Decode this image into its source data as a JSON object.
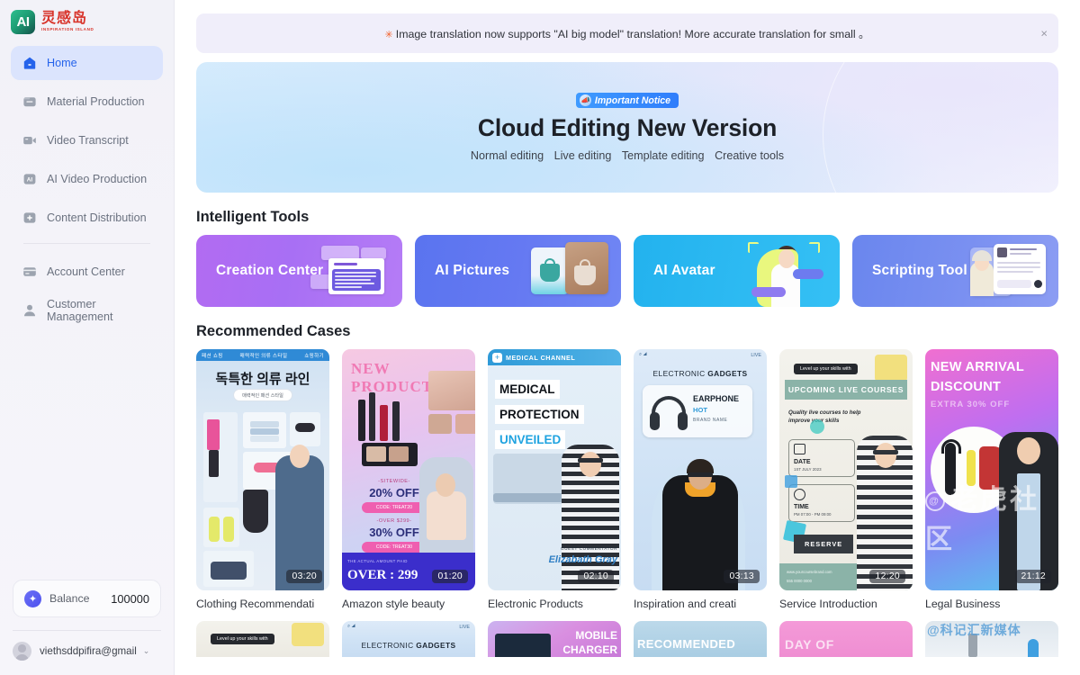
{
  "brand": {
    "logo_mark": "AI",
    "name_cn": "灵感岛",
    "name_en": "INSPIRATION ISLAND",
    "logo_icon": "ai-logo-icon"
  },
  "sidebar": {
    "items": [
      {
        "label": "Home",
        "icon": "home-icon",
        "active": true
      },
      {
        "label": "Material Production",
        "icon": "folder-icon",
        "active": false
      },
      {
        "label": "Video Transcript",
        "icon": "video-camera-icon",
        "active": false
      },
      {
        "label": "AI Video Production",
        "icon": "ai-square-icon",
        "active": false
      },
      {
        "label": "Content Distribution",
        "icon": "plus-square-icon",
        "active": false
      },
      {
        "label": "Account Center",
        "icon": "card-icon",
        "active": false
      },
      {
        "label": "Customer Management",
        "icon": "user-icon",
        "active": false
      }
    ],
    "balance": {
      "label": "Balance",
      "value": "100000",
      "icon": "coin-icon"
    },
    "account": {
      "email": "viethsddpifira@gmail",
      "caret": "⌄",
      "avatar": "user-avatar"
    }
  },
  "notice": {
    "emoji": "✳",
    "text": "Image translation now supports \"AI big model\" translation! More accurate translation for small 。",
    "close": "×"
  },
  "hero": {
    "badge": "Important Notice",
    "badge_icon": "megaphone-icon",
    "title": "Cloud Editing New Version",
    "subtitle_items": [
      "Normal editing",
      "Live editing",
      "Template editing",
      "Creative tools"
    ]
  },
  "tools": {
    "heading": "Intelligent Tools",
    "items": [
      {
        "label": "Creation Center",
        "color": "#a86ff4"
      },
      {
        "label": "AI Pictures",
        "color": "#6579f2"
      },
      {
        "label": "AI Avatar",
        "color": "#2dbaf2"
      },
      {
        "label": "Scripting Tool",
        "color": "#7a90f1"
      }
    ]
  },
  "cases": {
    "heading": "Recommended Cases",
    "items": [
      {
        "title": "Clothing Recommendati",
        "duration": "03:20",
        "theme": "th-clothing",
        "overlay": {
          "band_left": "패션 쇼핑",
          "band_center": "매력적인 의류 스타일",
          "band_right": "쇼핑하기",
          "headline": "독특한 의류 라인",
          "pill": "매력적인 패션 스타일"
        }
      },
      {
        "title": "Amazon style beauty",
        "duration": "01:20",
        "theme": "th-beauty",
        "overlay": {
          "l1": "NEW",
          "l2": "PRODUCT",
          "promo1_kicker": "-SITEWIDE-",
          "promo1": "20% OFF",
          "promo1_code": "CODE: TREAT20",
          "promo2_kicker": "-OVER $299-",
          "promo2": "30% OFF",
          "promo2_code": "CODE: TREAT30",
          "footer_kicker": "THE ACTUAL AMOUNT PAID",
          "footer": "OVER : 299"
        }
      },
      {
        "title": "Electronic Products",
        "duration": "02:10",
        "theme": "th-medical",
        "overlay": {
          "channel": "MEDICAL CHANNEL",
          "l1": "MEDICAL",
          "l2": "PROTECTION",
          "l3": "UNVEILED",
          "guest_label": "GUEST COMMENTATOR",
          "guest_name": "Elizabath Gray"
        }
      },
      {
        "title": "Inspiration and creati",
        "duration": "03:13",
        "theme": "th-gadget",
        "overlay": {
          "status_live": "LIVE",
          "brand_light": "ELECTRONIC",
          "brand_bold": "GADGETS",
          "product": "EARPHONE",
          "tag": "HOT",
          "sub": "BRAND NAME"
        }
      },
      {
        "title": "Service Introduction",
        "duration": "12:20",
        "theme": "th-service",
        "overlay": {
          "kicker": "Level up your skills with",
          "banner": "UPCOMING LIVE COURSES",
          "blurb": "Quality live courses to help improve your skills",
          "date_label": "DATE",
          "date_value": "1ST JULY 2023",
          "time_label": "TIME",
          "time_value": "PM 07:00 - PM 09:00",
          "cta": "RESERVE",
          "contact_web": "www.yourcoursebrand.com",
          "contact_tel": "555 0000 0000"
        }
      },
      {
        "title": "Legal Business",
        "duration": "21:12",
        "theme": "th-legal",
        "overlay": {
          "l1": "NEW ARRIVAL",
          "l2": "DISCOUNT",
          "l3": "EXTRA 30% OFF"
        }
      }
    ],
    "items_row2": [
      {
        "theme": "th-service",
        "overlay": {
          "kicker": "Level up your skills with"
        }
      },
      {
        "theme": "th-gadget",
        "overlay": {
          "brand_light": "ELECTRONIC",
          "brand_bold": "GADGETS",
          "status_live": "LIVE"
        }
      },
      {
        "theme": "th-mobile",
        "overlay": {
          "l1": "MOBILE",
          "l2": "CHARGER"
        }
      },
      {
        "theme": "th-rec",
        "overlay": {
          "l1": "RECOMMENDED"
        }
      },
      {
        "theme": "th-day",
        "overlay": {
          "l1": "DAY OF"
        }
      },
      {
        "theme": "th-last",
        "overlay": {}
      }
    ]
  },
  "watermark": {
    "badge": "@",
    "big": "老虎社区",
    "small": "科记汇新媒体"
  }
}
